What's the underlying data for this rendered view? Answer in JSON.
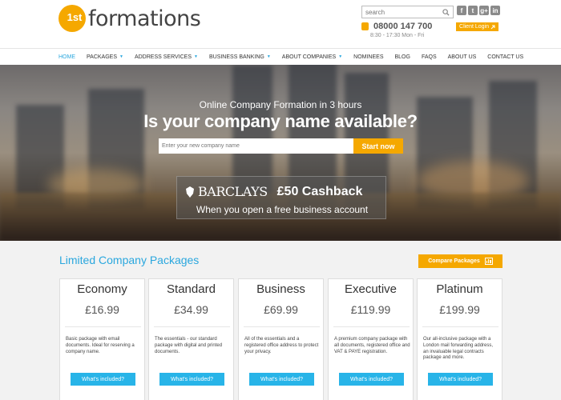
{
  "header": {
    "logo_sup": "1st",
    "logo_text": "formations",
    "search_placeholder": "search",
    "phone": "08000 147 700",
    "hours": "8:30 - 17:30 Mon - Fri",
    "client_login": "Client Login",
    "social": [
      "f",
      "t",
      "g+",
      "in"
    ]
  },
  "nav": {
    "items": [
      {
        "label": "HOME"
      },
      {
        "label": "PACKAGES"
      },
      {
        "label": "ADDRESS SERVICES"
      },
      {
        "label": "BUSINESS BANKING"
      },
      {
        "label": "ABOUT COMPANIES"
      },
      {
        "label": "NOMINEES"
      },
      {
        "label": "BLOG"
      },
      {
        "label": "FAQS"
      },
      {
        "label": "ABOUT US"
      },
      {
        "label": "CONTACT US"
      }
    ]
  },
  "hero": {
    "subtitle": "Online Company Formation in 3 hours",
    "title": "Is your company name available?",
    "input_placeholder": "Enter your new company name",
    "cta": "Start now",
    "banner_brand": "BARCLAYS",
    "banner_offer": "£50 Cashback",
    "banner_sub": "When you open a free business account"
  },
  "packages": {
    "title": "Limited Company Packages",
    "compare_label": "Compare Packages",
    "items": [
      {
        "name": "Economy",
        "price": "£16.99",
        "desc": "Basic package with email documents. Ideal for reserving a company name.",
        "button": "What's included?"
      },
      {
        "name": "Standard",
        "price": "£34.99",
        "desc": "The essentials - our standard package with digital and printed documents.",
        "button": "What's included?"
      },
      {
        "name": "Business",
        "price": "£69.99",
        "desc": "All of the essentials and a registered office address to protect your privacy.",
        "button": "What's included?"
      },
      {
        "name": "Executive",
        "price": "£119.99",
        "desc": "A premium company package with all documents, registered office and VAT & PAYE registration.",
        "button": "What's included?"
      },
      {
        "name": "Platinum",
        "price": "£199.99",
        "desc": "Our all-inclusive package with a London mail forwarding address, an invaluable legal contracts package and more.",
        "button": "What's included?"
      }
    ]
  },
  "colors": {
    "accent": "#f5a800",
    "link": "#2aa7de",
    "button": "#28b4e8"
  }
}
